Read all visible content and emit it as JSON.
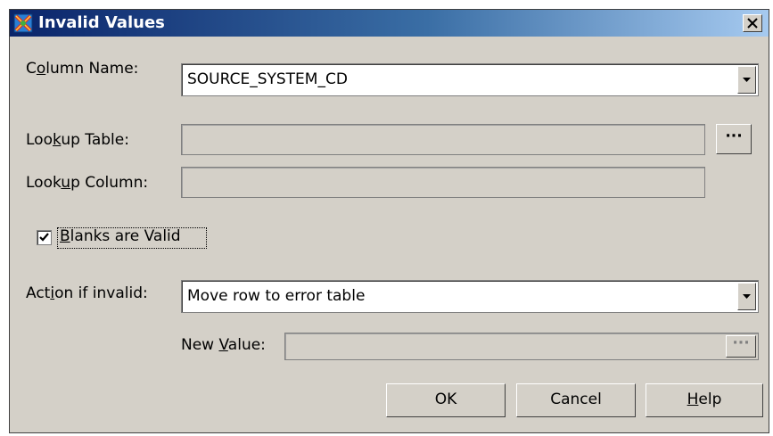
{
  "window": {
    "title": "Invalid Values",
    "close_icon": "close-icon"
  },
  "column_name": {
    "label_pre": "C",
    "label_key": "o",
    "label_post": "lumn Name:",
    "value": "SOURCE_SYSTEM_CD"
  },
  "lookup_table": {
    "label_pre": "Loo",
    "label_key": "k",
    "label_post": "up Table:",
    "value": "",
    "browse_label": "···"
  },
  "lookup_column": {
    "label_pre": "Look",
    "label_key": "u",
    "label_post": "p Column:",
    "value": ""
  },
  "blanks_valid": {
    "label_key": "B",
    "label_post": "lanks are Valid",
    "checked": true
  },
  "action": {
    "label_pre": "Act",
    "label_key": "i",
    "label_post": "on if invalid:",
    "value": "Move row to error table"
  },
  "new_value": {
    "label_pre": "New ",
    "label_key": "V",
    "label_post": "alue:",
    "value": "",
    "browse_label": "···"
  },
  "buttons": {
    "ok": "OK",
    "cancel": "Cancel",
    "help_key": "H",
    "help_post": "elp"
  }
}
